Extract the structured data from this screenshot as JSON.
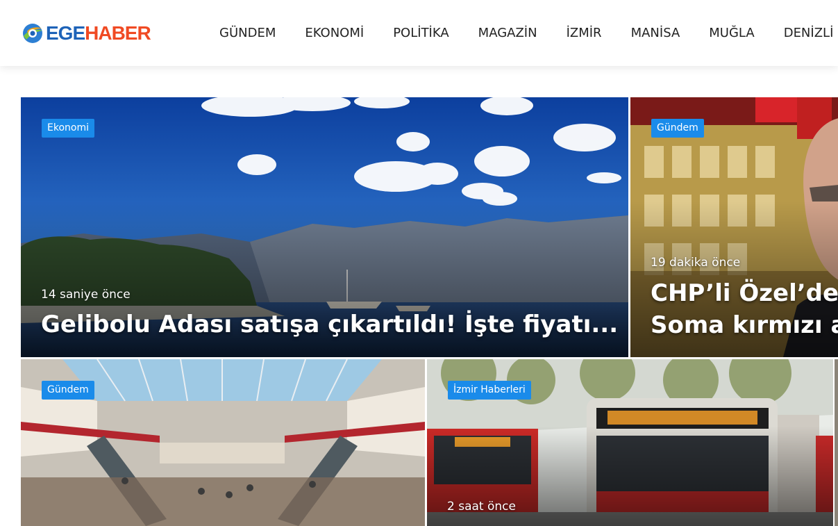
{
  "header": {
    "logo": {
      "part1": "EGE",
      "part2": "HABER"
    },
    "nav": [
      "GÜNDEM",
      "EKONOMİ",
      "POLİTİKA",
      "MAGAZİN",
      "İZMİR",
      "MANİSA",
      "MUĞLA",
      "DENİZLİ"
    ]
  },
  "cards": [
    {
      "category": "Ekonomi",
      "time": "14 saniye önce",
      "title": "Gelibolu Adası satışa çıkartıldı! İşte fiyatı..."
    },
    {
      "category": "Gündem",
      "time": "19 dakika önce",
      "title_line1": "CHP’li Özel’den",
      "title_line2": "Soma kırmızı alarm"
    },
    {
      "category": "Gündem"
    },
    {
      "category": "İzmir Haberleri",
      "time": "2 saat önce"
    }
  ],
  "colors": {
    "accent": "#1a8bea",
    "logo_blue": "#1e63b8",
    "logo_orange": "#f04a23"
  }
}
